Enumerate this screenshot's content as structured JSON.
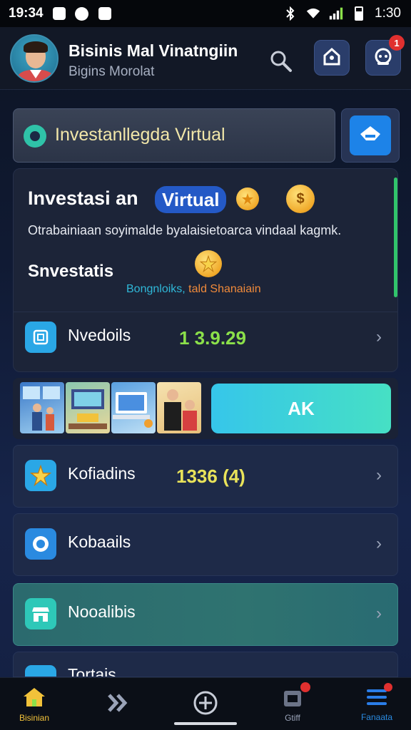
{
  "status_bar": {
    "time_left": "19:34",
    "time_right": "1:30"
  },
  "header": {
    "title": "Bisinis Mal Vinatngiin",
    "subtitle": "Bigins Morolat",
    "notification_count": "1"
  },
  "banner": {
    "text": "Investanllegda Virtual"
  },
  "card": {
    "title": "Investasi an",
    "pill": "Virtual",
    "coin_symbol": "$",
    "description": "Otrabainiaan soyimalde byalaisietoarсa vindaal kagmk.",
    "subtitle": "Snvestatis",
    "colored_part1": "Bongnloiks,",
    "colored_part2": "tald Shanaiain",
    "row_label": "Nvedoils",
    "row_value": "1 3.9.29"
  },
  "action_button": {
    "label": "AK"
  },
  "list": [
    {
      "label": "Kofiadins",
      "value": "1336 (4)"
    },
    {
      "label": "Kobaails",
      "value": ""
    },
    {
      "label": "Nooalibis",
      "value": ""
    },
    {
      "label": "Tortais",
      "value": ""
    }
  ],
  "bottom_nav": {
    "items": [
      {
        "label": "Bisinian"
      },
      {
        "label": ""
      },
      {
        "label": ""
      },
      {
        "label": "Gtiff"
      },
      {
        "label": "Fanaata"
      }
    ]
  },
  "colors": {
    "accent_blue": "#1d83e8",
    "accent_teal": "#46e0c4",
    "green_value": "#8be04a",
    "yellow_value": "#e9e35a"
  }
}
